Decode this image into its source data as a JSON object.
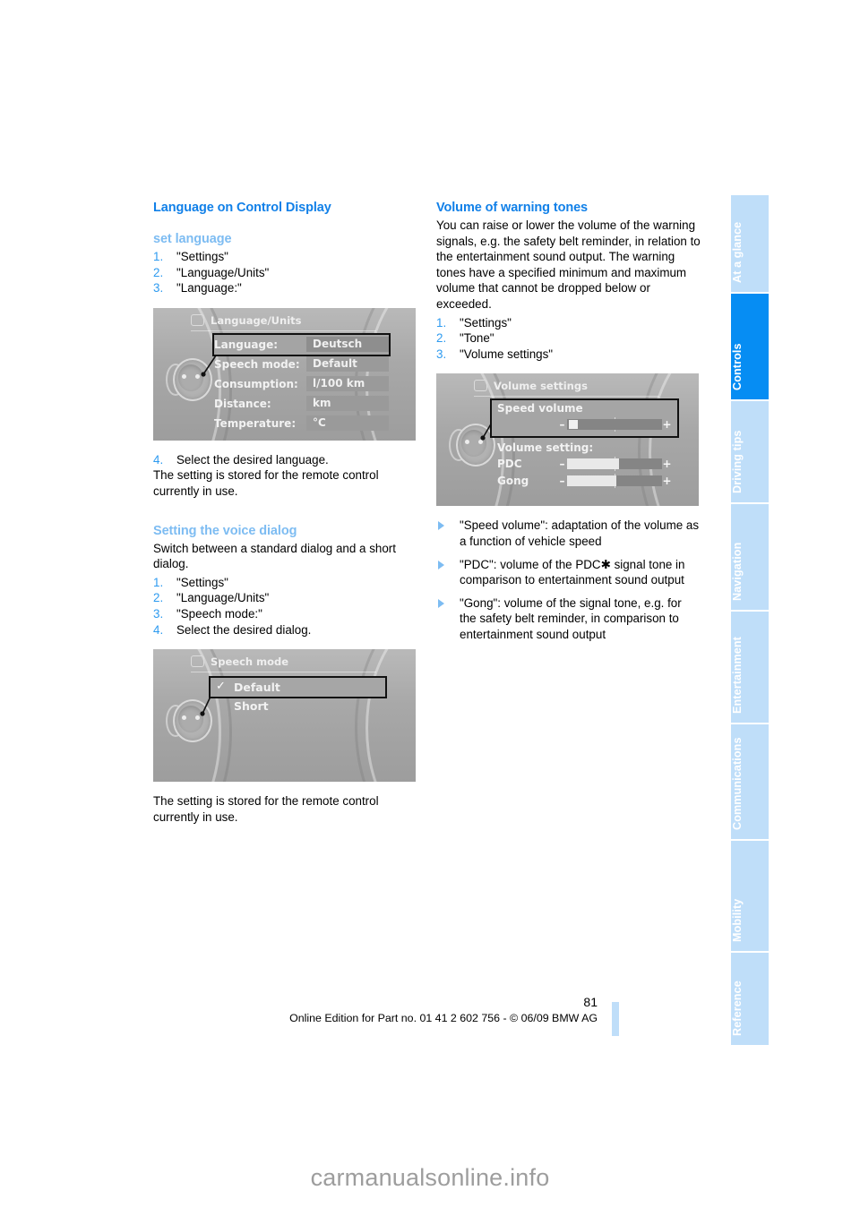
{
  "document": {
    "page_number": "81",
    "edition_line": "Online Edition for Part no. 01 41 2 602 756 - © 06/09 BMW AG",
    "watermark": "carmanualsonline.info"
  },
  "colors": {
    "heading_blue": "#1180e8",
    "subheading_blue": "#7dbcf2",
    "step_number_blue": "#2e9bf0",
    "tab_inactive": "#bfdef9",
    "tab_active": "#068df3"
  },
  "tabs": [
    {
      "label": "At a glance",
      "active": false
    },
    {
      "label": "Controls",
      "active": true
    },
    {
      "label": "Driving tips",
      "active": false
    },
    {
      "label": "Navigation",
      "active": false
    },
    {
      "label": "Entertainment",
      "active": false
    },
    {
      "label": "Communications",
      "active": false
    },
    {
      "label": "Mobility",
      "active": false
    },
    {
      "label": "Reference",
      "active": false
    }
  ],
  "left_column": {
    "section_title": "Language on Control Display",
    "sub1": {
      "title": "set language",
      "steps": [
        {
          "num": "1.",
          "text": "\"Settings\""
        },
        {
          "num": "2.",
          "text": "\"Language/Units\""
        },
        {
          "num": "3.",
          "text": "\"Language:\""
        }
      ],
      "step4": {
        "num": "4.",
        "text": "Select the desired language."
      },
      "note": "The setting is stored for the remote control currently in use."
    },
    "sub2": {
      "title": "Setting the voice dialog",
      "intro": "Switch between a standard dialog and a short dialog.",
      "steps": [
        {
          "num": "1.",
          "text": "\"Settings\""
        },
        {
          "num": "2.",
          "text": "\"Language/Units\""
        },
        {
          "num": "3.",
          "text": "\"Speech mode:\""
        },
        {
          "num": "4.",
          "text": "Select the desired dialog."
        }
      ],
      "note": "The setting is stored for the remote control currently in use."
    },
    "figure_language": {
      "header": "Language/Units",
      "header_icon": "settings-icon",
      "rows": [
        {
          "label": "Language:",
          "value": "Deutsch",
          "selected": true
        },
        {
          "label": "Speech mode:",
          "value": "Default",
          "selected": false
        },
        {
          "label": "Consumption:",
          "value": "l/100 km",
          "selected": false
        },
        {
          "label": "Distance:",
          "value": "km",
          "selected": false
        },
        {
          "label": "Temperature:",
          "value": "°C",
          "selected": false
        }
      ]
    },
    "figure_speech": {
      "header": "Speech mode",
      "header_icon": "settings-icon",
      "choices": [
        {
          "label": "Default",
          "checked": true,
          "selected": true
        },
        {
          "label": "Short",
          "checked": false,
          "selected": false
        }
      ]
    }
  },
  "right_column": {
    "section_title": "Volume of warning tones",
    "intro": "You can raise or lower the volume of the warning signals, e.g. the safety belt reminder, in relation to the entertainment sound output. The warning tones have a specified minimum and maximum volume that cannot be dropped below or exceeded.",
    "steps": [
      {
        "num": "1.",
        "text": "\"Settings\""
      },
      {
        "num": "2.",
        "text": "\"Tone\""
      },
      {
        "num": "3.",
        "text": "\"Volume settings\""
      }
    ],
    "figure_volume": {
      "header": "Volume settings",
      "header_icon": "tone-icon",
      "speed_group": {
        "title": "Speed volume",
        "selected": true,
        "slider": {
          "minus": "–",
          "plus": "+",
          "fill_percent": 8
        }
      },
      "setting_group": {
        "title": "Volume setting:",
        "rows": [
          {
            "name": "PDC",
            "minus": "–",
            "plus": "+",
            "fill_percent": 55
          },
          {
            "name": "Gong",
            "minus": "–",
            "plus": "+",
            "fill_percent": 52
          }
        ]
      }
    },
    "bullets": [
      {
        "pre": "\"Speed volume\": adaptation of the volume as a function of vehicle speed",
        "asterisk": false,
        "post": ""
      },
      {
        "pre": "\"PDC\": volume of the PDC",
        "asterisk": true,
        "post": " signal tone in comparison to entertainment sound output"
      },
      {
        "pre": "\"Gong\": volume of the signal tone, e.g. for the safety belt reminder, in comparison to entertainment sound output",
        "asterisk": false,
        "post": ""
      }
    ]
  }
}
